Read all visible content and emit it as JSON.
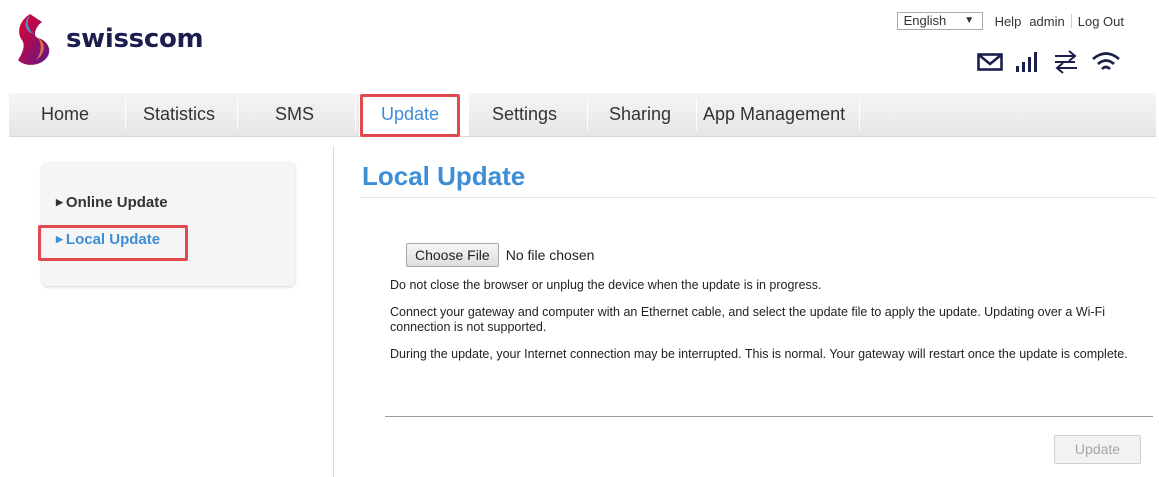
{
  "brand": {
    "name": "swisscom"
  },
  "top": {
    "language": "English",
    "help": "Help",
    "user": "admin",
    "logout": "Log Out"
  },
  "nav": {
    "items": [
      "Home",
      "Statistics",
      "SMS",
      "Update",
      "Settings",
      "Sharing",
      "App Management"
    ],
    "active": "Update"
  },
  "sidebar": {
    "items": [
      "Online Update",
      "Local Update"
    ],
    "active": "Local Update"
  },
  "main": {
    "title": "Local Update",
    "choose_file": "Choose File",
    "file_status": "No file chosen",
    "paragraphs": [
      "Do not close the browser or unplug the device when the update is in progress.",
      "Connect your gateway and computer with an Ethernet cable, and select the update file to apply the update. Updating over a Wi-Fi connection is not supported.",
      "During the update, your Internet connection may be interrupted. This is normal. Your gateway will restart once the update is complete."
    ],
    "update_button": "Update"
  },
  "status_icons": [
    "mail-icon",
    "signal-strength-icon",
    "data-transfer-icon",
    "wifi-icon"
  ],
  "colors": {
    "accent": "#3d8ed6",
    "highlight": "#e0494d",
    "brand_text": "#1a1f4d"
  }
}
